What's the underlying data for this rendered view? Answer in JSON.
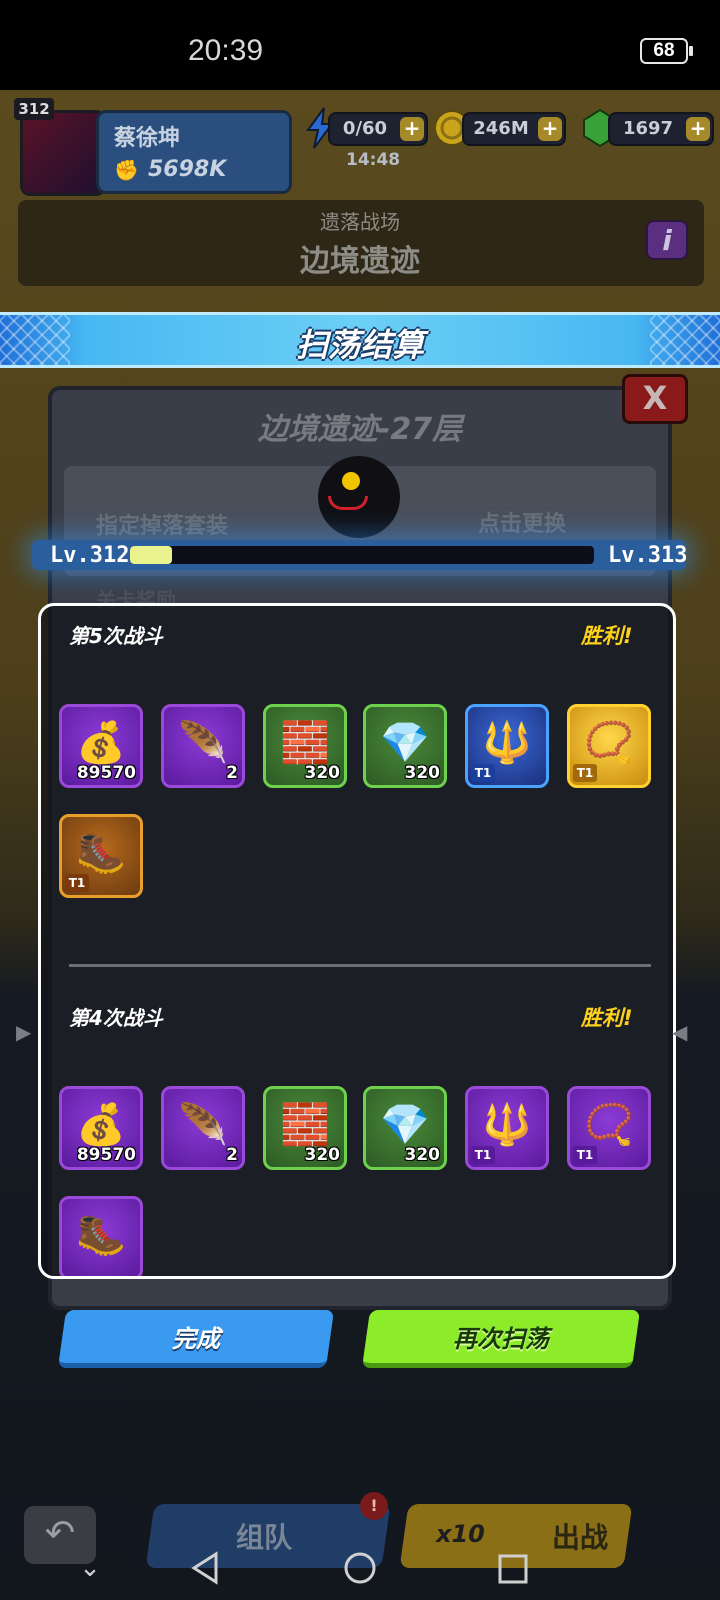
{
  "status_bar": {
    "time": "20:39",
    "battery": "68"
  },
  "player": {
    "level": "312",
    "name": "蔡徐坤",
    "power": "5698K"
  },
  "resources": {
    "energy": "0/60",
    "energy_timer": "14:48",
    "gold": "246M",
    "gems": "1697",
    "plus": "+"
  },
  "stage": {
    "category": "遗落战场",
    "name": "边境遗迹",
    "info": "i"
  },
  "sweep": {
    "title": "扫荡结算",
    "dialog_title": "边境遗迹-27层",
    "close": "X",
    "drop_set_label": "指定掉落套装",
    "change_label": "点击更换",
    "stage_reward_label": "关卡奖励",
    "level_current": "Lv.312",
    "level_next": "Lv.313",
    "level_progress": 0.09
  },
  "battles": [
    {
      "label": "第5次战斗",
      "result": "胜利!",
      "items": [
        {
          "kind": "gold-coins",
          "glyph": "💰",
          "qty": "89570",
          "rarity": "purple"
        },
        {
          "kind": "purple-feather",
          "glyph": "🪶",
          "qty": "2",
          "rarity": "purple"
        },
        {
          "kind": "silver-ingot",
          "glyph": "🧱",
          "qty": "320",
          "rarity": "green"
        },
        {
          "kind": "green-crystal",
          "glyph": "💎",
          "qty": "320",
          "rarity": "green"
        },
        {
          "kind": "crystal-scepter",
          "glyph": "🔱",
          "tier": "T1",
          "rarity": "blue"
        },
        {
          "kind": "gold-amulet",
          "glyph": "📿",
          "tier": "T1",
          "rarity": "gold"
        },
        {
          "kind": "spiked-boots",
          "glyph": "🥾",
          "tier": "T1",
          "rarity": "orange"
        }
      ]
    },
    {
      "label": "第4次战斗",
      "result": "胜利!",
      "items": [
        {
          "kind": "gold-coins",
          "glyph": "💰",
          "qty": "89570",
          "rarity": "purple"
        },
        {
          "kind": "purple-feather",
          "glyph": "🪶",
          "qty": "2",
          "rarity": "purple"
        },
        {
          "kind": "silver-ingot",
          "glyph": "🧱",
          "qty": "320",
          "rarity": "green"
        },
        {
          "kind": "green-crystal",
          "glyph": "💎",
          "qty": "320",
          "rarity": "green"
        },
        {
          "kind": "trident-weapon",
          "glyph": "🔱",
          "tier": "T1",
          "rarity": "purple"
        },
        {
          "kind": "blue-amulet",
          "glyph": "📿",
          "tier": "T1",
          "rarity": "purple"
        },
        {
          "kind": "spiked-boots",
          "glyph": "🥾",
          "rarity": "purple"
        }
      ]
    }
  ],
  "buttons": {
    "done": "完成",
    "sweep_again": "再次扫荡"
  },
  "bottom": {
    "team": "组队",
    "fight_cost": "x10",
    "fight": "出战"
  },
  "colors": {
    "victory": "#ffd21a",
    "ribbon": "#6ccff5",
    "done": "#3a9af0",
    "again": "#8cec2a"
  }
}
